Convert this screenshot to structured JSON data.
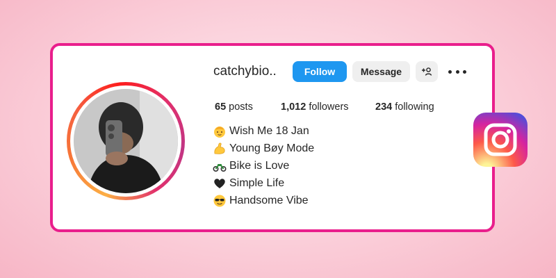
{
  "profile": {
    "username": "catchybio..",
    "follow_label": "Follow",
    "message_label": "Message",
    "stats": {
      "posts_count": "65",
      "posts_label": "posts",
      "followers_count": "1,012",
      "followers_label": "followers",
      "following_count": "234",
      "following_label": "following"
    },
    "bio": [
      {
        "icon": "baby-face-icon",
        "text": "Wish Me 18 Jan"
      },
      {
        "icon": "flexed-biceps-icon",
        "text": "Young Bøy Mode"
      },
      {
        "icon": "motorbike-icon",
        "text": "Bike is Love"
      },
      {
        "icon": "black-heart-icon",
        "text": "Simple Life"
      },
      {
        "icon": "sunglasses-face-icon",
        "text": "Handsome Vibe"
      }
    ]
  },
  "colors": {
    "card_border": "#e91e8c",
    "follow_button": "#1e97f0",
    "secondary_button": "#efefef",
    "text": "#262626"
  }
}
